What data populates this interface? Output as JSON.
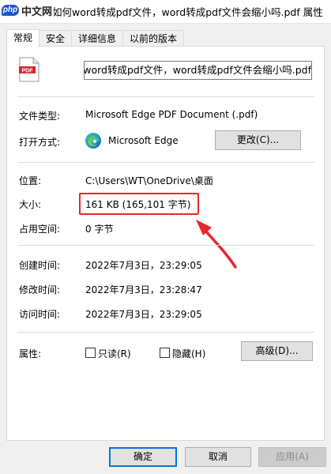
{
  "window": {
    "title": "如何word转成pdf文件，word转成pdf文件会缩小吗.pdf 属性",
    "watermark": "中文网",
    "watermark_badge": "php"
  },
  "tabs": [
    {
      "label": "常规",
      "active": true
    },
    {
      "label": "安全",
      "active": false
    },
    {
      "label": "详细信息",
      "active": false
    },
    {
      "label": "以前的版本",
      "active": false
    }
  ],
  "file": {
    "icon": "pdf-file-icon",
    "icon_text": "PDF",
    "name": "如何word转成pdf文件，word转成pdf文件会缩小吗.pdf"
  },
  "type_section": {
    "file_type_label": "文件类型:",
    "file_type_value": "Microsoft Edge PDF Document (.pdf)",
    "open_with_label": "打开方式:",
    "open_with_value": "Microsoft Edge",
    "change_button": "更改(C)..."
  },
  "location_section": {
    "location_label": "位置:",
    "location_value": "C:\\Users\\WT\\OneDrive\\桌面",
    "size_label": "大小:",
    "size_value": "161 KB (165,101 字节)",
    "size_on_disk_label": "占用空间:",
    "size_on_disk_value": "0 字节"
  },
  "dates_section": {
    "created_label": "创建时间:",
    "created_value": "2022年7月3日，23:29:05",
    "modified_label": "修改时间:",
    "modified_value": "2022年7月3日，23:28:47",
    "accessed_label": "访问时间:",
    "accessed_value": "2022年7月3日，23:29:05"
  },
  "attributes": {
    "label": "属性:",
    "readonly_label": "只读(R)",
    "readonly_checked": false,
    "hidden_label": "隐藏(H)",
    "hidden_checked": false,
    "advanced_button": "高级(D)..."
  },
  "footer": {
    "ok_button": "确定",
    "cancel_button": "取消",
    "apply_button": "应用(A)"
  },
  "annotation": {
    "color": "#e8262c"
  }
}
